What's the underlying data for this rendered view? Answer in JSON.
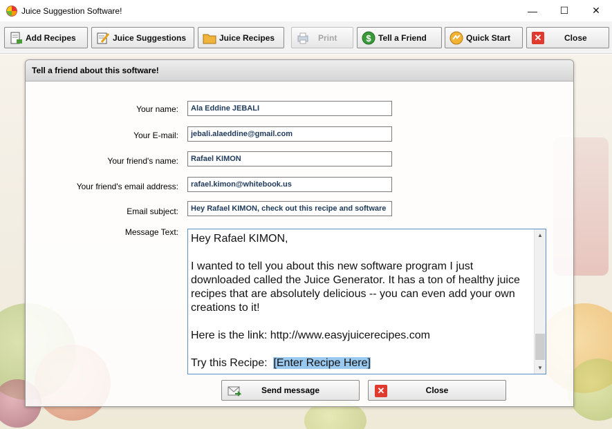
{
  "window": {
    "title": "Juice Suggestion Software!",
    "minimize": "—",
    "maximize": "☐",
    "close": "✕"
  },
  "toolbar": {
    "add_recipes": "Add Recipes",
    "juice_suggestions": "Juice Suggestions",
    "juice_recipes": "Juice Recipes",
    "print": "Print",
    "tell_a_friend": "Tell a Friend",
    "quick_start": "Quick Start",
    "close": "Close"
  },
  "dialog": {
    "title": "Tell a friend about this software!",
    "labels": {
      "your_name": "Your name:",
      "your_email": "Your E-mail:",
      "friend_name": "Your friend's name:",
      "friend_email": "Your friend's email address:",
      "subject": "Email subject:",
      "message": "Message Text:"
    },
    "values": {
      "your_name": "Ala Eddine JEBALI",
      "your_email": "jebali.alaeddine@gmail.com",
      "friend_name": "Rafael KIMON",
      "friend_email": "rafael.kimon@whitebook.us",
      "subject": "Hey Rafael KIMON, check out this recipe and software"
    },
    "message": {
      "greeting": "Hey Rafael KIMON,",
      "body": "I wanted to tell you about this new software program I just downloaded called the Juice Generator. It has a ton of healthy juice recipes that are absolutely delicious -- you can even add your own creations to it!",
      "link": "Here is the link:  http://www.easyjuicerecipes.com",
      "recipe_prefix": "Try this Recipe:  ",
      "recipe_placeholder": "[Enter Recipe Here]"
    },
    "send_button": "Send message",
    "close_button": "Close"
  }
}
